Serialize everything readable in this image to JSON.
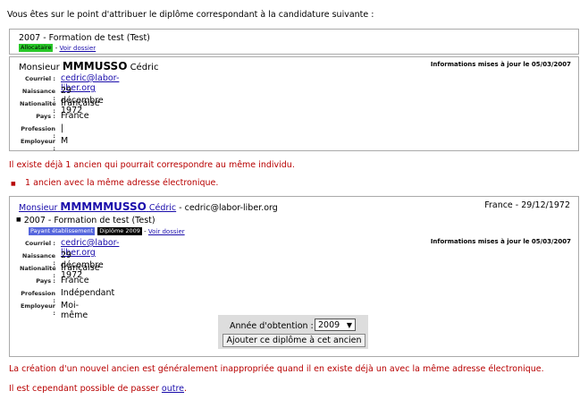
{
  "intro": "Vous êtes sur le point d'attribuer le diplôme correspondant à la candidature suivante :",
  "candidature": {
    "formation": "2007 - Formation de test (Test)",
    "badge": "Allocataire",
    "sep": " - ",
    "link": "Voir dossier"
  },
  "person": {
    "civility": "Monsieur",
    "lastname": "MMMUSSO",
    "firstname": "Cédric",
    "updated": "Informations mises à jour le 05/03/2007",
    "fields": [
      {
        "label": "Courriel :",
        "value": "cedric@labor-liber.org",
        "link": true
      },
      {
        "label": "Naissance :",
        "value": "29 décembre 1972",
        "link": false
      },
      {
        "label": "Nationalité :",
        "value": "française",
        "link": false
      },
      {
        "label": "Pays :",
        "value": "France",
        "link": false
      },
      {
        "label": "Profession :",
        "value": "|",
        "link": false
      },
      {
        "label": "Employeur :",
        "value": "M",
        "link": false
      }
    ]
  },
  "warning": "Il existe déjà 1 ancien qui pourrait correspondre au même individu.",
  "match_bullet": "1 ancien avec la même adresse électronique.",
  "ancien": {
    "civility": "Monsieur",
    "lastname": "MMMMMUSSO",
    "firstname": "Cédric",
    "email_inline": " - cedric@labor-liber.org",
    "country_date": "France - 29/12/1972",
    "formation": "2007 - Formation de test (Test)",
    "badge1": "Payant établissement",
    "badge2": "Diplôme 2009",
    "sep": " - ",
    "link": "Voir dossier",
    "updated": "Informations mises à jour le 05/03/2007",
    "fields": [
      {
        "label": "Courriel :",
        "value": "cedric@labor-liber.org",
        "link": true
      },
      {
        "label": "Naissance :",
        "value": "29 décembre 1972",
        "link": false
      },
      {
        "label": "Nationalité :",
        "value": "française",
        "link": false
      },
      {
        "label": "Pays :",
        "value": "France",
        "link": false
      },
      {
        "label": "Profession :",
        "value": "Indépendant",
        "link": false
      },
      {
        "label": "Employeur :",
        "value": "Moi-même",
        "link": false
      }
    ],
    "year_label": "Année d'obtention :",
    "year_value": "2009",
    "add_button": "Ajouter ce diplôme à cet ancien"
  },
  "footer": {
    "warning": "La création d'un nouvel ancien est généralement inappropriée quand il en existe déjà un avec la même adresse électronique.",
    "bypass_prefix": "Il est cependant possible de passer ",
    "bypass_link": "outre",
    "bypass_suffix": "."
  }
}
